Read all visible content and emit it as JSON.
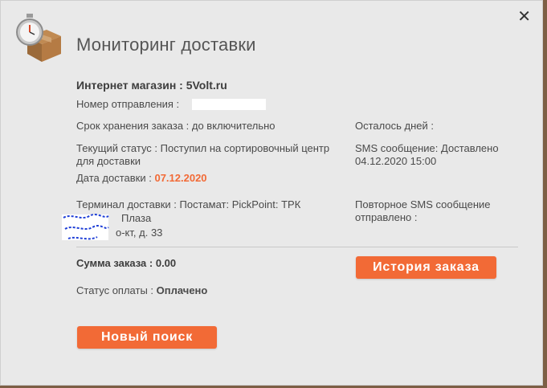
{
  "modal": {
    "close_glyph": "✕",
    "title": "Мониторинг доставки"
  },
  "info": {
    "shop_label": "Интернет магазин : 5Volt.ru",
    "tracking_label": "Номер отправления :",
    "storage": "Срок хранения заказа : до включительно",
    "days_left": "Осталось дней :",
    "status_text": "Текущий статус : Поступил на сортировочный центр для доставки",
    "sms_text": "SMS сообщение: Доставлено 04.12.2020 15:00",
    "date_label": "Дата доставки :",
    "date_value": "07.12.2020",
    "terminal": "Терминал доставки : Постамат: PickPoint: ТРК",
    "address_line1": "Плаза",
    "address_line2": "о-кт, д. 33",
    "resend_sms": "Повторное SMS сообщение отправлено :",
    "sum": "Сумма заказа : 0.00",
    "payment_label": "Статус оплаты :",
    "payment_value": "Оплачено"
  },
  "buttons": {
    "history": "История заказа",
    "new_search": "Новый поиск"
  },
  "colors": {
    "accent": "#f26a36",
    "panel": "#e9e9e9"
  },
  "icons": {
    "logo": "stopwatch-box-icon",
    "close": "close-icon"
  }
}
